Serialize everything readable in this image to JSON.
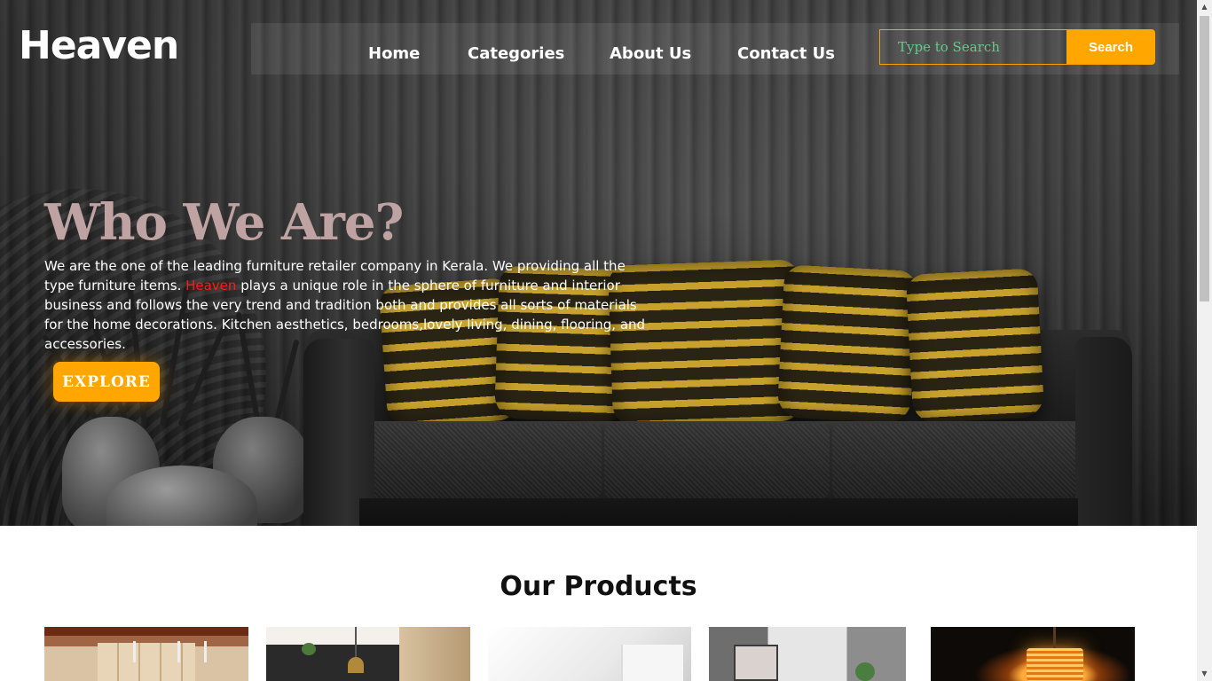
{
  "brand": {
    "logo": "Heaven"
  },
  "nav": {
    "items": [
      {
        "label": "Home"
      },
      {
        "label": "Categories"
      },
      {
        "label": "About Us"
      },
      {
        "label": "Contact Us"
      }
    ],
    "search": {
      "placeholder": "Type to Search",
      "button_label": "Search"
    }
  },
  "hero": {
    "title": "Who We Are?",
    "text_part1": "We are the one of the leading furniture retailer company in Kerala. We providing all the type furniture items. ",
    "text_brand": "Heaven",
    "text_part2": " plays a unique role in the sphere of furniture and interior business and follows the very trend and tradition both and provides all sorts of materials for the home decorations. Kitchen aesthetics, bedrooms,lovely living, dining, flooring, and accessories.",
    "cta_label": "EXPLORE"
  },
  "products": {
    "title": "Our Products"
  },
  "colors": {
    "accent": "#ffa600",
    "brand_highlight": "#ff1a1a",
    "hero_title": "#bfa3a3"
  }
}
